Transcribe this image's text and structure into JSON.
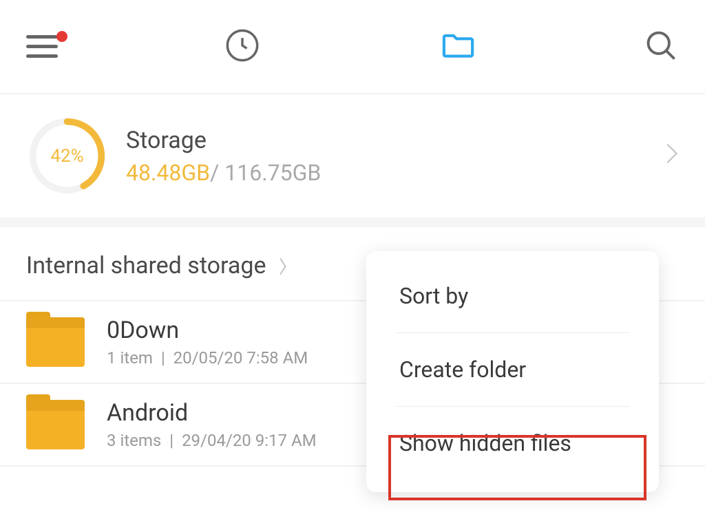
{
  "toolbar": {
    "menu_has_notification": true
  },
  "storage": {
    "title": "Storage",
    "percent_label": "42%",
    "percent_value": 42,
    "used": "48.48GB",
    "separator": "/ ",
    "total": "116.75GB"
  },
  "breadcrumb": {
    "label": "Internal shared storage"
  },
  "files": [
    {
      "name": "0Down",
      "items": "1 item",
      "date": "20/05/20 7:58 AM"
    },
    {
      "name": "Android",
      "items": "3 items",
      "date": "29/04/20 9:17 AM"
    }
  ],
  "context_menu": {
    "sort_by": "Sort by",
    "create_folder": "Create folder",
    "show_hidden": "Show hidden files"
  },
  "colors": {
    "accent": "#f2b93b",
    "folder_tab_active": "#2aa9ee",
    "highlight": "#d8362a"
  }
}
